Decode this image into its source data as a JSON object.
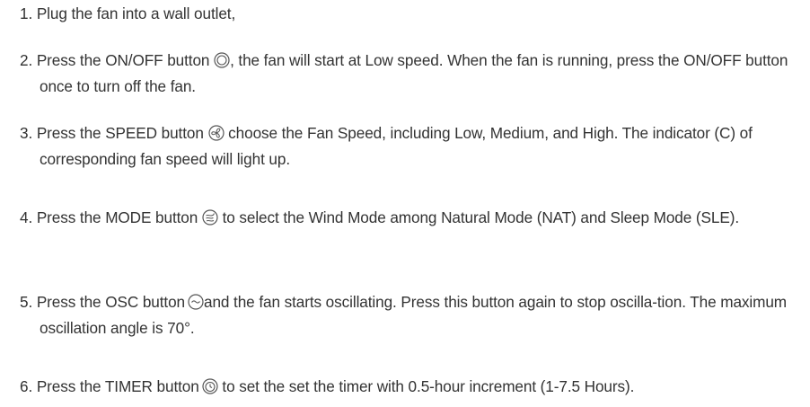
{
  "steps": [
    {
      "num": "1.",
      "text": " Plug the fan into a wall outlet,"
    },
    {
      "num": "2.",
      "before": " Press the ON/OFF button ",
      "icon": "power-button-icon",
      "after": ", the fan will start at Low speed. When the fan is running, press the ON/OFF button once to turn off the fan."
    },
    {
      "num": "3.",
      "before": " Press the SPEED button ",
      "icon": "fan-speed-icon",
      "after": " choose the Fan Speed, including Low, Medium, and High. The indicator (C) of corresponding fan speed will light up."
    },
    {
      "num": "4.",
      "before": " Press the MODE button ",
      "icon": "wind-mode-icon",
      "after": " to select the Wind Mode among Natural Mode (NAT) and Sleep Mode (SLE)."
    },
    {
      "num": "5.",
      "before": " Press the OSC button",
      "icon": "oscillation-icon",
      "after": "and the fan starts oscillating. Press this button again to stop oscilla-tion. The maximum oscillation angle is 70°."
    },
    {
      "num": "6.",
      "before": " Press the TIMER button",
      "icon": "timer-icon",
      "after": " to set the set the timer with 0.5-hour increment (1-7.5 Hours)."
    }
  ],
  "colors": {
    "text": "#333333",
    "icon_stroke": "#555555"
  }
}
